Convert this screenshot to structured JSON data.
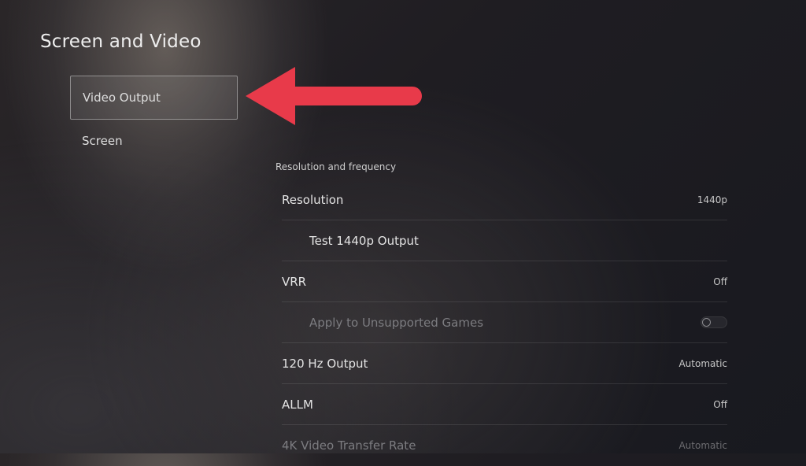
{
  "page": {
    "title": "Screen and Video"
  },
  "menu": {
    "items": [
      {
        "label": "Video Output",
        "selected": true
      },
      {
        "label": "Screen",
        "selected": false
      }
    ]
  },
  "content": {
    "section_title": "Resolution and frequency",
    "rows": [
      {
        "label": "Resolution",
        "value": "1440p"
      },
      {
        "label": "Test 1440p Output",
        "value": ""
      },
      {
        "label": "VRR",
        "value": "Off"
      },
      {
        "label": "Apply to Unsupported Games",
        "toggle": "off"
      },
      {
        "label": "120 Hz Output",
        "value": "Automatic"
      },
      {
        "label": "ALLM",
        "value": "Off"
      },
      {
        "label": "4K Video Transfer Rate",
        "value": "Automatic"
      }
    ]
  },
  "annotation": {
    "arrow_color": "#e83a4a"
  }
}
